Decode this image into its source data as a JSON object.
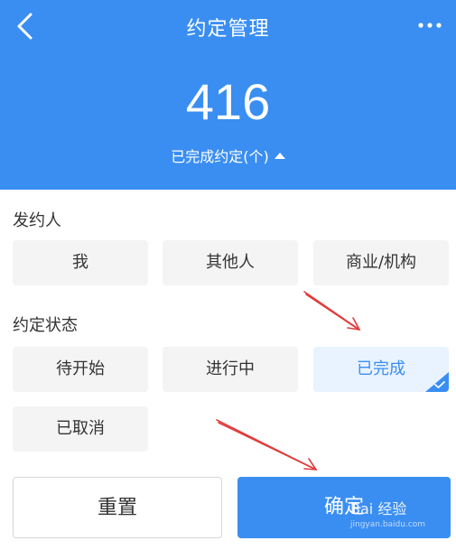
{
  "header": {
    "title": "约定管理",
    "count": "416",
    "count_label": "已完成约定(个)"
  },
  "initiator": {
    "label": "发约人",
    "options": [
      "我",
      "其他人",
      "商业/机构"
    ]
  },
  "status": {
    "label": "约定状态",
    "options": [
      "待开始",
      "进行中",
      "已完成",
      "已取消"
    ],
    "selected": "已完成"
  },
  "buttons": {
    "reset": "重置",
    "confirm": "确定"
  },
  "watermark": {
    "text": "Bai 经验",
    "url": "jingyan.baidu.com"
  },
  "colors": {
    "accent": "#3a8ef2",
    "annotation_arrow": "#e23b3b"
  },
  "icons": [
    "back-icon",
    "more-icon",
    "caret-up-icon",
    "checkmark-icon"
  ]
}
